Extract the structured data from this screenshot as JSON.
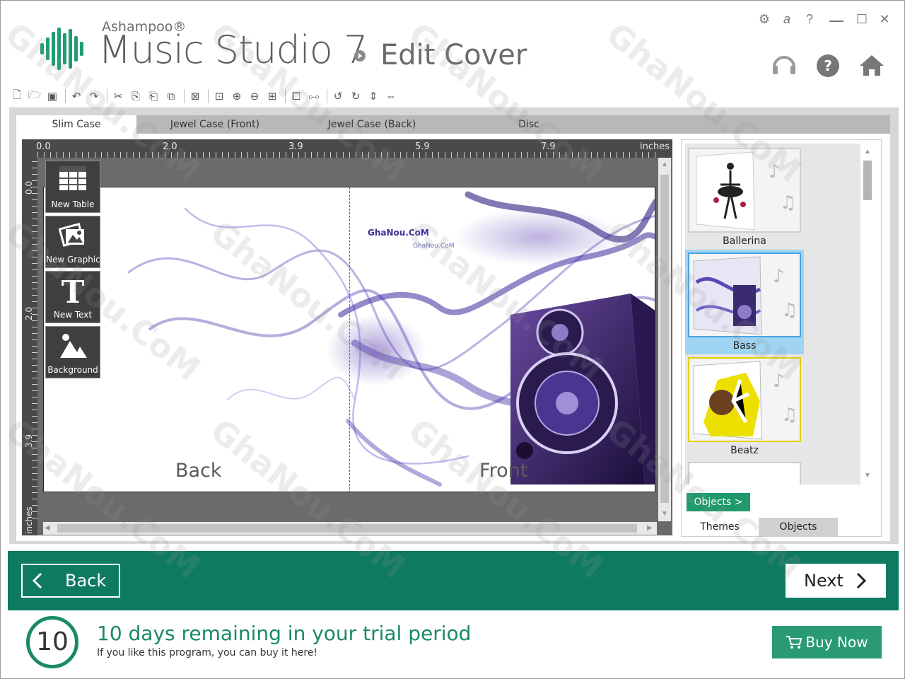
{
  "app": {
    "vendor": "Ashampoo®",
    "product": "Music Studio 7",
    "page": "Edit Cover"
  },
  "window_controls": {
    "settings": "⚙",
    "ashampoo": "a",
    "help": "?",
    "maximize": "☐",
    "close": "✕"
  },
  "tabs": [
    "Slim Case",
    "Jewel Case (Front)",
    "Jewel Case (Back)",
    "Disc"
  ],
  "active_tab": "Slim Case",
  "ruler": {
    "h_labels": [
      "0.0",
      "2.0",
      "3.9",
      "5.9",
      "7.9",
      "inches"
    ],
    "v_labels": [
      "0.0",
      "2.0",
      "3.9",
      "inches"
    ]
  },
  "tools": [
    {
      "label": "New Table",
      "icon": "table-icon"
    },
    {
      "label": "New Graphic",
      "icon": "graphic-icon"
    },
    {
      "label": "New Text",
      "icon": "text-icon"
    },
    {
      "label": "Background",
      "icon": "background-icon"
    }
  ],
  "cover": {
    "back_label": "Back",
    "front_label": "Front",
    "watermark_1": "GhaNou.CoM",
    "watermark_2": "GhaNou.CoM"
  },
  "themes": [
    {
      "name": "Ballerina",
      "selected": false
    },
    {
      "name": "Bass",
      "selected": true
    },
    {
      "name": "Beatz",
      "selected": false
    }
  ],
  "right_panel": {
    "objects_button": "Objects >",
    "tabs": [
      "Themes",
      "Objects"
    ],
    "active_tab": "Themes"
  },
  "nav": {
    "back": "Back",
    "next": "Next"
  },
  "trial": {
    "days": "10",
    "title": "10 days remaining in your trial period",
    "subtitle": "If you like this program, you can buy it here!",
    "buy": "Buy Now"
  },
  "watermark_text": "GhaNou.CoM",
  "colors": {
    "accent_green": "#0e7a62",
    "buy_green": "#2a9a72",
    "selection_blue": "#9fd4f2"
  }
}
